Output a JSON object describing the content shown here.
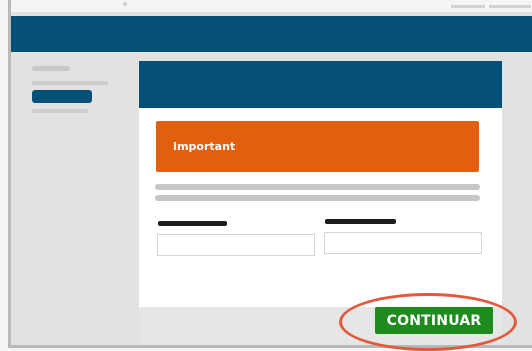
{
  "colors": {
    "header": "#045076",
    "alert": "#e25f0d",
    "button": "#1f8a1d",
    "highlight": "#e25a3b"
  },
  "card": {
    "alert_title": "Important"
  },
  "footer": {
    "continue_label": "CONTINUAR"
  }
}
